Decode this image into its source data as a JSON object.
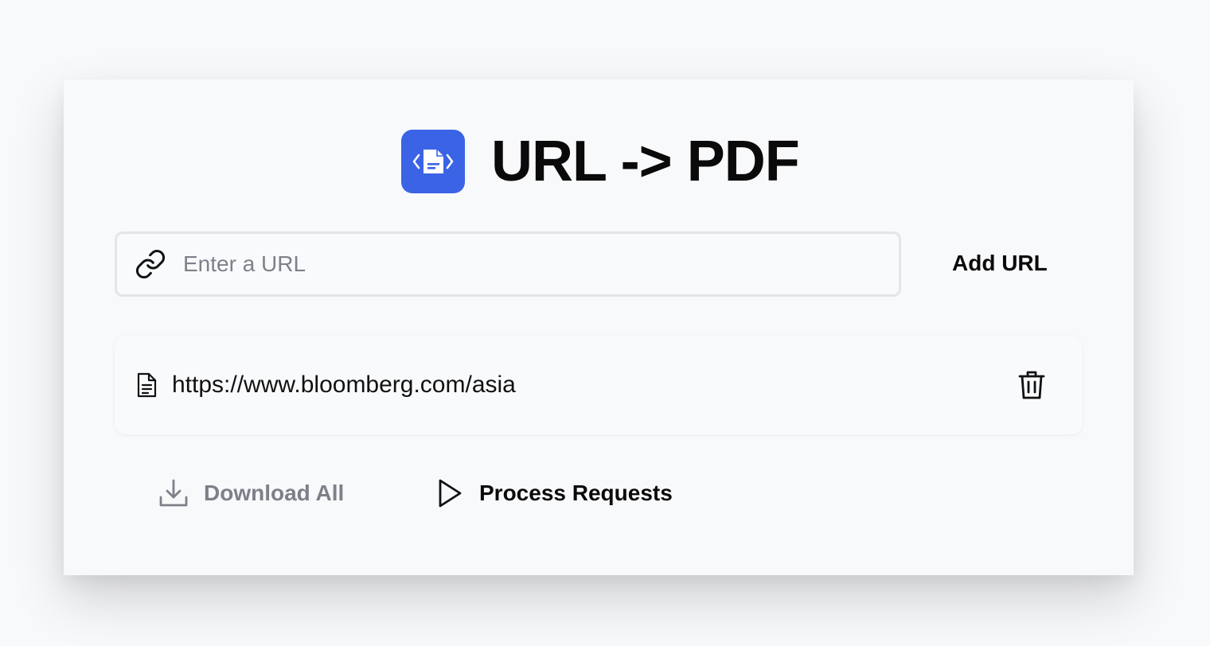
{
  "app": {
    "title": "URL -> PDF",
    "accent_color": "#3a63e6",
    "logo_icon": "file-code-icon"
  },
  "input": {
    "placeholder": "Enter a URL",
    "value": "",
    "icon": "link-icon"
  },
  "add_button": {
    "label": "Add URL"
  },
  "url_list": {
    "items": [
      {
        "url": "https://www.bloomberg.com/asia",
        "icon": "document-icon",
        "delete_icon": "trash-icon"
      }
    ]
  },
  "actions": {
    "download_all": {
      "label": "Download All",
      "icon": "download-icon",
      "disabled": true
    },
    "process_requests": {
      "label": "Process Requests",
      "icon": "play-icon"
    }
  }
}
